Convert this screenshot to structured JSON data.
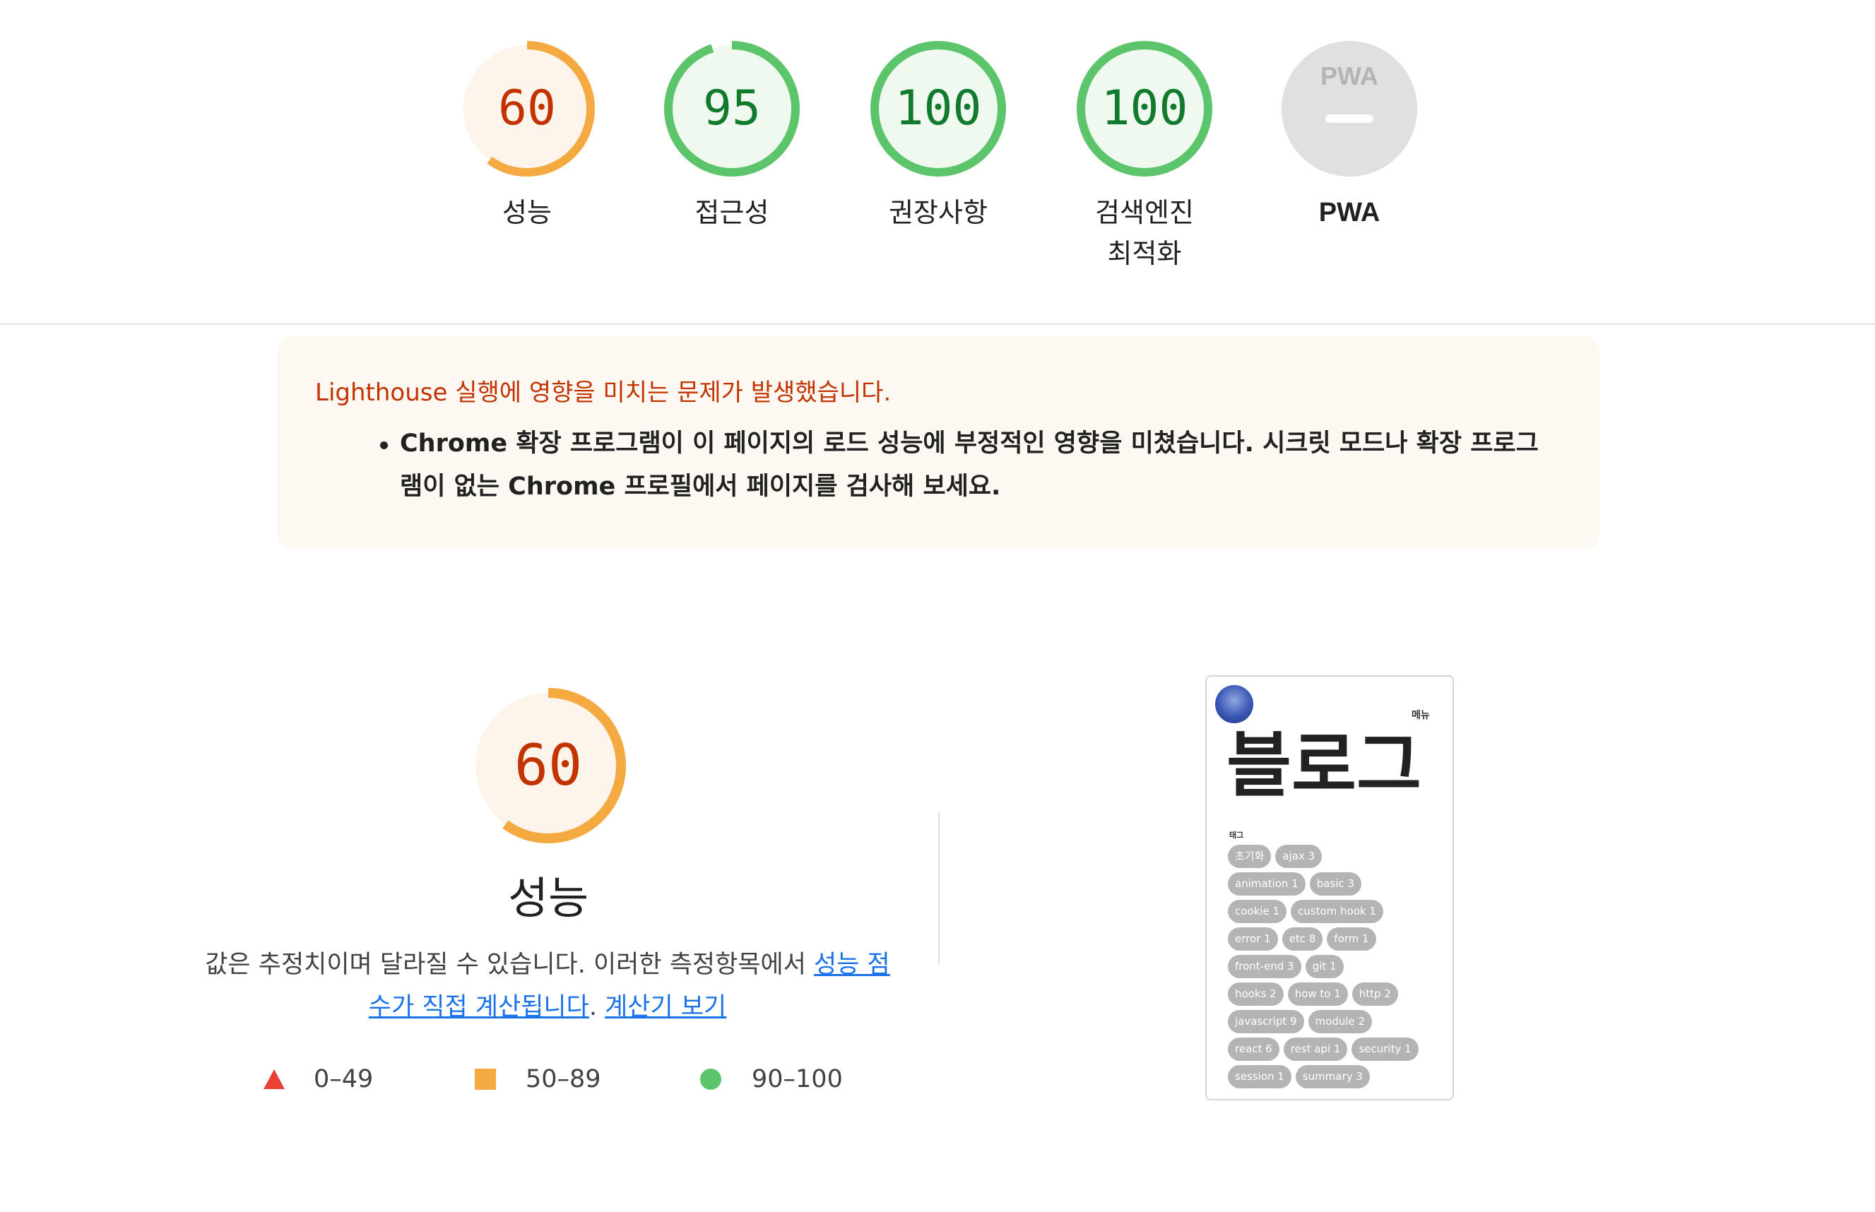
{
  "scores": [
    {
      "value": "60",
      "label": "성능",
      "fraction": 0.6,
      "rating": "average"
    },
    {
      "value": "95",
      "label": "접근성",
      "fraction": 0.95,
      "rating": "pass"
    },
    {
      "value": "100",
      "label": "권장사항",
      "fraction": 1.0,
      "rating": "pass"
    },
    {
      "value": "100",
      "label_line1": "검색엔진",
      "label_line2": "최적화",
      "fraction": 1.0,
      "rating": "pass"
    }
  ],
  "pwa": {
    "label": "PWA",
    "badge_text": "PWA"
  },
  "warning": {
    "title": "Lighthouse 실행에 영향을 미치는 문제가 발생했습니다.",
    "items": [
      "Chrome 확장 프로그램이 이 페이지의 로드 성능에 부정적인 영향을 미쳤습니다. 시크릿 모드나 확장 프로그램이 없는 Chrome 프로필에서 페이지를 검사해 보세요."
    ]
  },
  "performance": {
    "score": "60",
    "fraction": 0.6,
    "title": "성능",
    "desc_prefix": "값은 추정치이며 달라질 수 있습니다. 이러한 측정항목에서 ",
    "desc_link": "성능 점수가 직접 계산됩니다",
    "desc_middle": ". ",
    "calc_link": "계산기 보기"
  },
  "legend": [
    {
      "range": "0–49",
      "shape": "triangle",
      "color": "#eb4034"
    },
    {
      "range": "50–89",
      "shape": "square",
      "color": "#f5a941"
    },
    {
      "range": "90–100",
      "shape": "circle",
      "color": "#5cc46a"
    }
  ],
  "colors": {
    "average_stroke": "#f5a941",
    "average_fill": "#fdf5ec",
    "average_text": "#c33300",
    "pass_stroke": "#5cc46a",
    "pass_fill": "#eff9f0",
    "pass_text": "#117a2c",
    "pwa_fill": "#e0e0e0"
  },
  "screenshot": {
    "menu": "메뉴",
    "title": "블로그",
    "tag_label": "태그",
    "tag_rows": [
      [
        "초기화",
        "ajax 3"
      ],
      [
        "animation 1",
        "basic 3"
      ],
      [
        "cookie 1",
        "custom hook 1"
      ],
      [
        "error 1",
        "etc 8",
        "form 1"
      ],
      [
        "front-end 3",
        "git 1"
      ],
      [
        "hooks 2",
        "how to 1",
        "http 2"
      ],
      [
        "javascript 9",
        "module 2"
      ],
      [
        "react 6",
        "rest api 1",
        "security 1"
      ],
      [
        "session 1",
        "summary 3"
      ]
    ]
  }
}
